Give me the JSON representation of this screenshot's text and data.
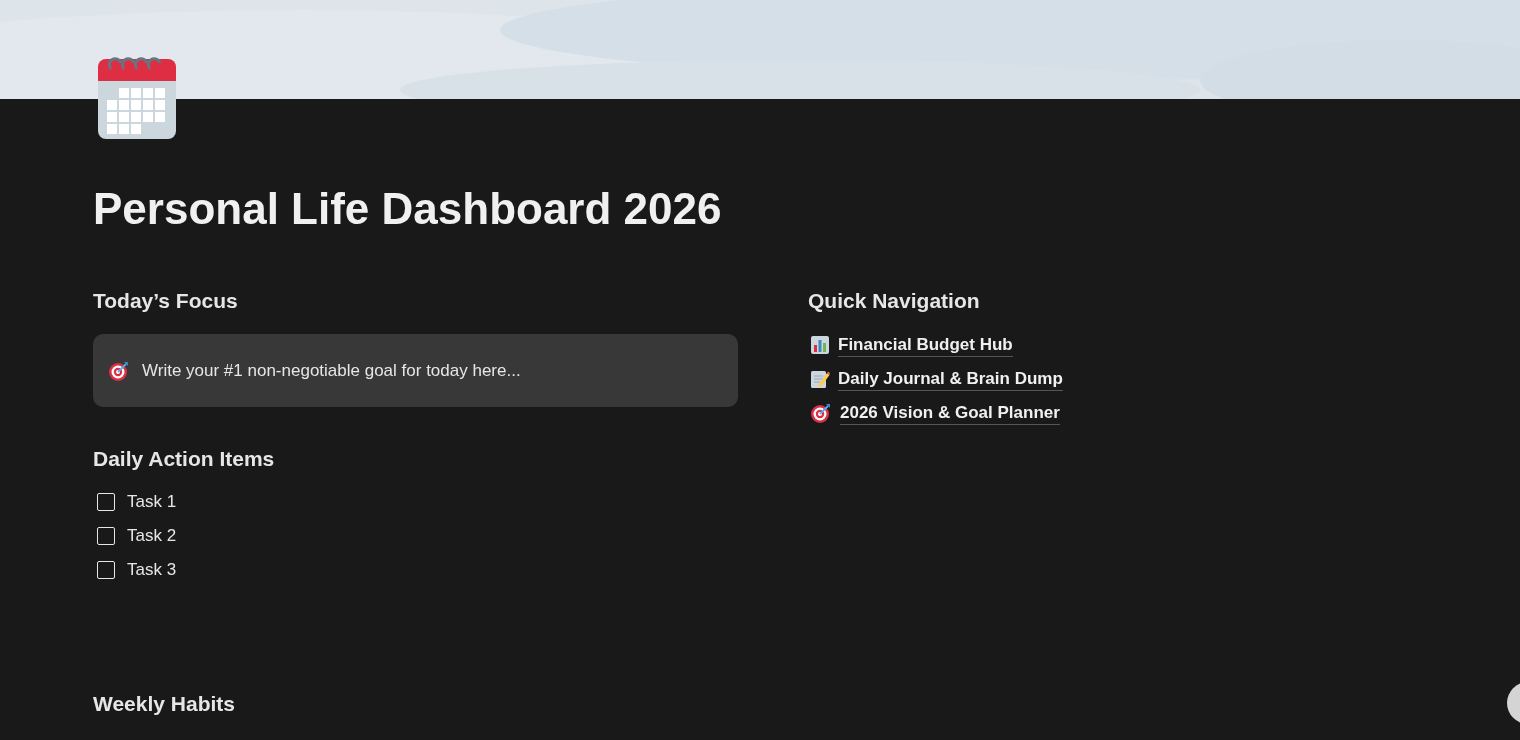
{
  "page": {
    "title": "Personal Life Dashboard 2026"
  },
  "focus": {
    "heading": "Today’s Focus",
    "callout": "Write your #1 non-negotiable goal for today here..."
  },
  "actions": {
    "heading": "Daily Action Items",
    "items": [
      {
        "label": "Task 1",
        "checked": false
      },
      {
        "label": "Task 2",
        "checked": false
      },
      {
        "label": "Task 3",
        "checked": false
      }
    ]
  },
  "navigation": {
    "heading": "Quick Navigation",
    "links": [
      {
        "label": "Financial Budget Hub",
        "kind": "chart"
      },
      {
        "label": "Daily Journal & Brain Dump",
        "kind": "memo"
      },
      {
        "label": "2026 Vision & Goal Planner",
        "kind": "target"
      }
    ]
  },
  "habits": {
    "heading": "Weekly Habits"
  }
}
